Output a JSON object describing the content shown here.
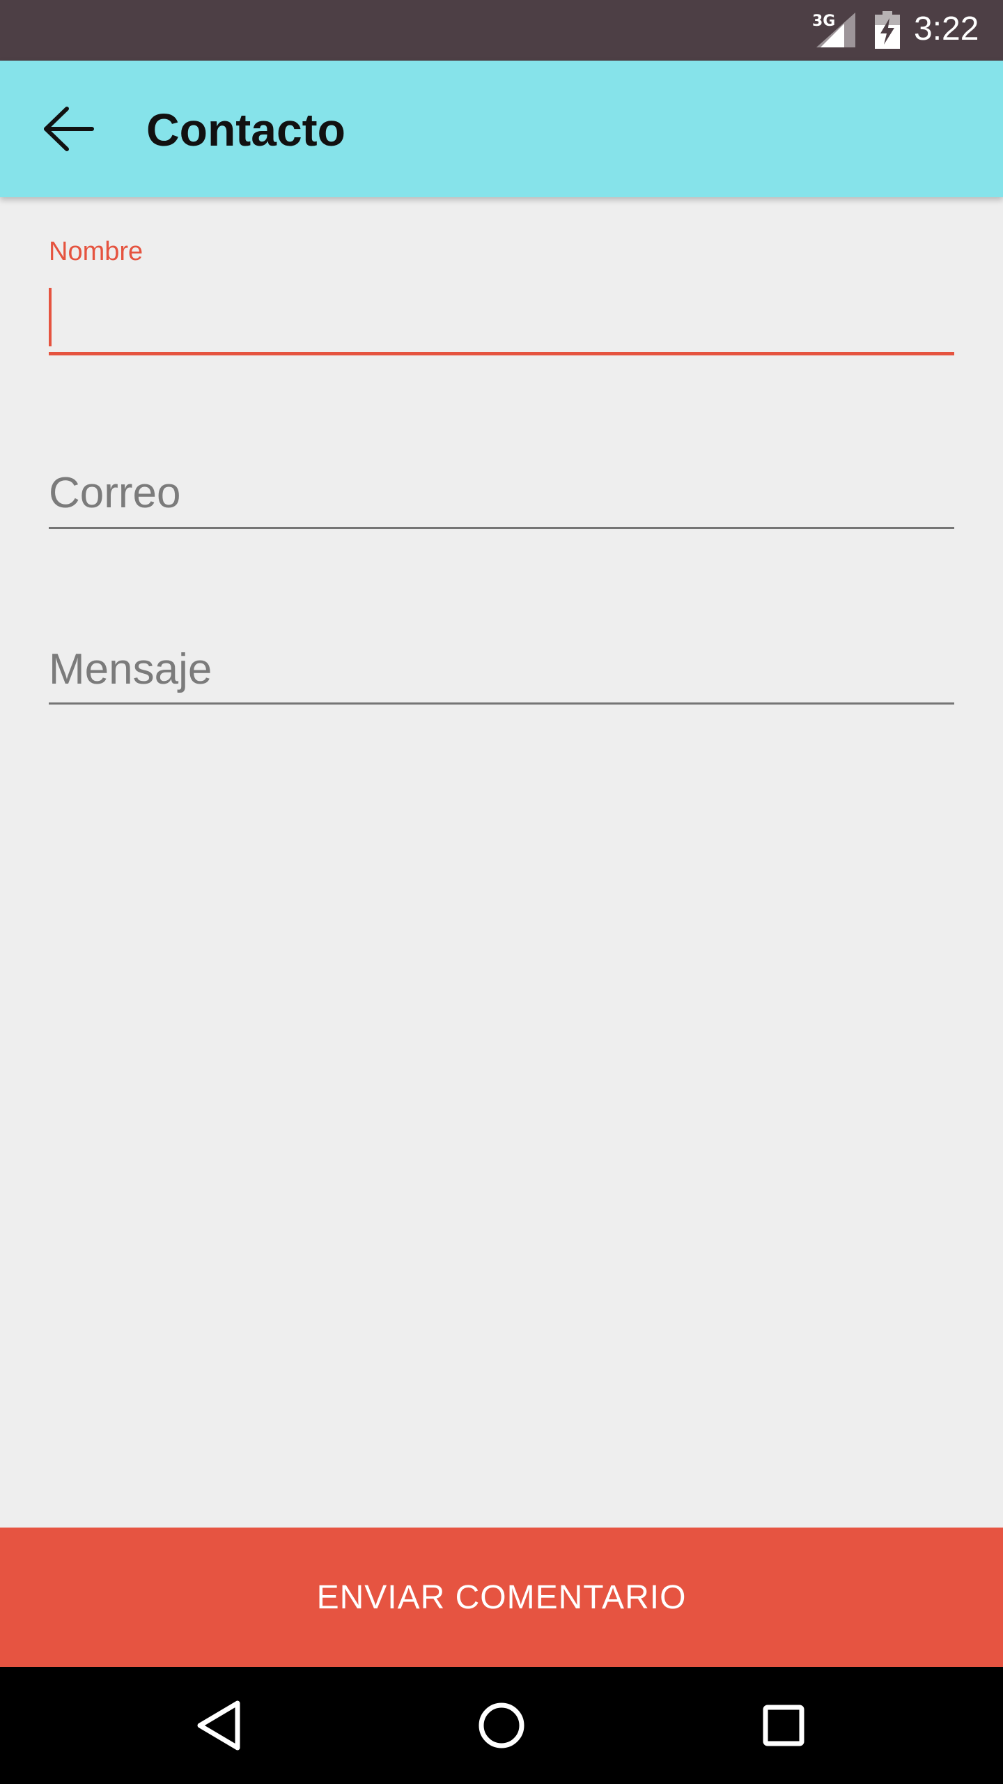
{
  "status_bar": {
    "network": "3G",
    "time": "3:22",
    "icons": [
      "signal-icon",
      "battery-charging-icon"
    ]
  },
  "app_bar": {
    "title": "Contacto",
    "back_icon": "arrow-back-icon",
    "background_color": "#86e3ea"
  },
  "form": {
    "nombre": {
      "label": "Nombre",
      "value": ""
    },
    "correo": {
      "placeholder": "Correo",
      "value": ""
    },
    "mensaje": {
      "placeholder": "Mensaje",
      "value": ""
    }
  },
  "submit": {
    "label": "ENVIAR COMENTARIO",
    "color": "#e65441"
  },
  "nav_bar": {
    "icons": [
      "back-triangle-icon",
      "home-circle-icon",
      "recents-square-icon"
    ]
  },
  "colors": {
    "accent": "#e5533f",
    "status_bar": "#4d3f45",
    "background": "#eeeeee"
  }
}
